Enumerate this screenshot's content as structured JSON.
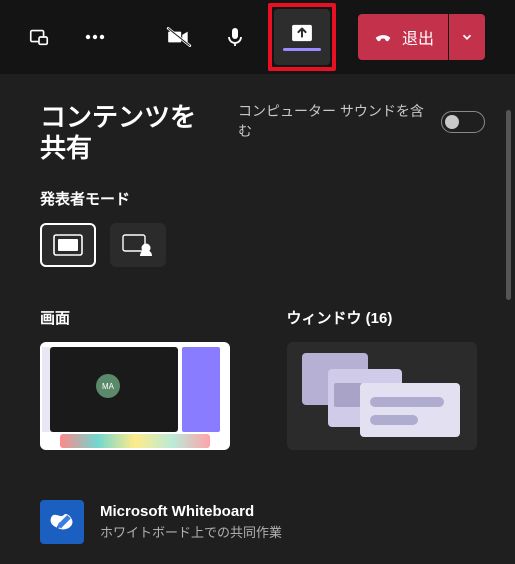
{
  "toolbar": {
    "leave_label": "退出"
  },
  "panel": {
    "title": "コンテンツを共有",
    "audio_label": "コンピューター サウンドを含む",
    "presenter_mode_label": "発表者モード"
  },
  "sections": {
    "screen": {
      "title": "画面"
    },
    "window": {
      "title": "ウィンドウ (16)"
    }
  },
  "whiteboard": {
    "title": "Microsoft Whiteboard",
    "subtitle": "ホワイトボード上での共同作業"
  },
  "screen_thumb": {
    "avatar_initials": "MA"
  }
}
